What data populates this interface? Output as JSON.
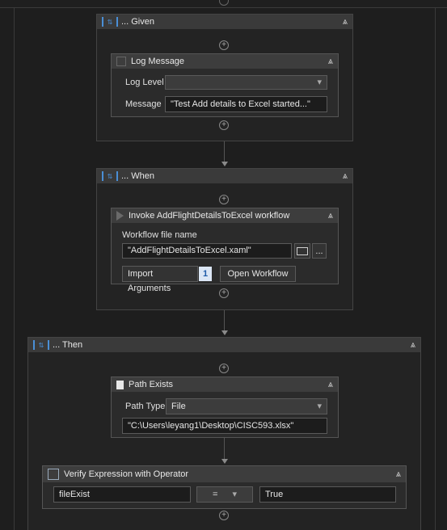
{
  "given": {
    "title": "... Given",
    "log": {
      "title": "Log Message",
      "level_label": "Log Level",
      "level_value": "",
      "message_label": "Message",
      "message_value": "\"Test Add details to Excel started...\""
    }
  },
  "when": {
    "title": "... When",
    "invoke": {
      "title": "Invoke AddFlightDetailsToExcel workflow",
      "file_label": "Workflow file name",
      "file_value": "\"AddFlightDetailsToExcel.xaml\"",
      "browse_label": "...",
      "import_label": "Import Arguments",
      "import_count": "1",
      "open_label": "Open Workflow"
    }
  },
  "then": {
    "title": "... Then",
    "path_exists": {
      "title": "Path Exists",
      "type_label": "Path Type",
      "type_value": "File",
      "path_value": "\"C:\\Users\\leyang1\\Desktop\\CISC593.xlsx\""
    },
    "verify": {
      "title": "Verify Expression with Operator",
      "left_value": "fileExist",
      "operator_value": "=",
      "right_value": "True"
    }
  },
  "icons": {
    "collapse": "⩓",
    "dropdown": "▾",
    "plus": "+"
  }
}
